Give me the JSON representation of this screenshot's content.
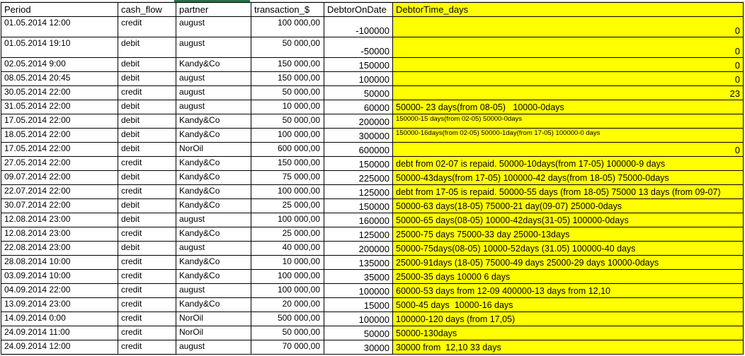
{
  "colors": {
    "highlight_yellow": "#ffff00",
    "selection_green": "#217346",
    "grid_border": "#000000"
  },
  "table": {
    "columns": [
      {
        "label": "Period"
      },
      {
        "label": "cash_flow"
      },
      {
        "label": "partner"
      },
      {
        "label": "transaction_$"
      },
      {
        "label": "DebtorOnDate"
      },
      {
        "label": "DebtorTime_days"
      }
    ],
    "rows": [
      {
        "period": "01.05.2014 12:00",
        "cash_flow": "credit",
        "partner": "august",
        "transaction": "100 000,00",
        "debtor_on_date": "-100000",
        "debtor_time_days": "0",
        "tall": true
      },
      {
        "period": "01.05.2014 19:10",
        "cash_flow": "debit",
        "partner": "august",
        "transaction": "50 000,00",
        "debtor_on_date": "-50000",
        "debtor_time_days": "0",
        "tall": true
      },
      {
        "period": "02.05.2014 9:00",
        "cash_flow": "debit",
        "partner": "Kandy&Co",
        "transaction": "150 000,00",
        "debtor_on_date": "150000",
        "debtor_time_days": "0"
      },
      {
        "period": "08.05.2014 20:45",
        "cash_flow": "debit",
        "partner": "august",
        "transaction": "150 000,00",
        "debtor_on_date": "100000",
        "debtor_time_days": "0"
      },
      {
        "period": "30.05.2014 22:00",
        "cash_flow": "credit",
        "partner": "august",
        "transaction": "50 000,00",
        "debtor_on_date": "50000",
        "debtor_time_days": "23"
      },
      {
        "period": "31.05.2014 22:00",
        "cash_flow": "debit",
        "partner": "august",
        "transaction": "10 000,00",
        "debtor_on_date": "60000",
        "debtor_time_days": "50000- 23 days(from 08-05)   10000-0days"
      },
      {
        "period": "17.05.2014 22:00",
        "cash_flow": "debit",
        "partner": "Kandy&Co",
        "transaction": "50 000,00",
        "debtor_on_date": "200000",
        "debtor_time_days": "150000-15 days(from 02-05) 50000-0days",
        "small": true
      },
      {
        "period": "18.05.2014 22:00",
        "cash_flow": "debit",
        "partner": "Kandy&Co",
        "transaction": "100 000,00",
        "debtor_on_date": "300000",
        "debtor_time_days": "150000-16days(from 02-05) 50000-1day(from 17-05) 100000-0 days",
        "small": true
      },
      {
        "period": "17.05.2014 22:00",
        "cash_flow": "debit",
        "partner": "NorOil",
        "transaction": "600 000,00",
        "debtor_on_date": "600000",
        "debtor_time_days": "0"
      },
      {
        "period": "27.05.2014 22:00",
        "cash_flow": "credit",
        "partner": "Kandy&Co",
        "transaction": "150 000,00",
        "debtor_on_date": "150000",
        "debtor_time_days": "debt from 02-07 is repaid. 50000-10days(from 17-05) 100000-9 days"
      },
      {
        "period": "09.07.2014 22:00",
        "cash_flow": "debit",
        "partner": "Kandy&Co",
        "transaction": "75 000,00",
        "debtor_on_date": "225000",
        "debtor_time_days": "50000-43days(from 17-05) 100000-42 days(from 18-05) 75000-0days"
      },
      {
        "period": "22.07.2014 22:00",
        "cash_flow": "credit",
        "partner": "Kandy&Co",
        "transaction": "100 000,00",
        "debtor_on_date": "125000",
        "debtor_time_days": "debt from 17-05 is repaid. 50000-55 days (from 18-05) 75000 13 days (from 09-07)"
      },
      {
        "period": "30.07.2014 22:00",
        "cash_flow": "debit",
        "partner": "Kandy&Co",
        "transaction": "25 000,00",
        "debtor_on_date": "150000",
        "debtor_time_days": "50000-63 days(18-05) 75000-21 day(09-07) 25000-0days"
      },
      {
        "period": "12.08.2014 23:00",
        "cash_flow": "debit",
        "partner": "august",
        "transaction": "100 000,00",
        "debtor_on_date": "160000",
        "debtor_time_days": "50000-65 days(08-05) 10000-42days(31-05) 100000-0days"
      },
      {
        "period": "12.08.2014 23:00",
        "cash_flow": "credit",
        "partner": "Kandy&Co",
        "transaction": "25 000,00",
        "debtor_on_date": "125000",
        "debtor_time_days": "25000-75 days 75000-33 day 25000-13days"
      },
      {
        "period": "22.08.2014 23:00",
        "cash_flow": "debit",
        "partner": "august",
        "transaction": "40 000,00",
        "debtor_on_date": "200000",
        "debtor_time_days": "50000-75days(08-05) 10000-52days (31.05) 100000-40 days"
      },
      {
        "period": "28.08.2014 10:00",
        "cash_flow": "credit",
        "partner": "Kandy&Co",
        "transaction": "10 000,00",
        "debtor_on_date": "135000",
        "debtor_time_days": "25000-91days (18-05) 75000-49 days 25000-29 days 10000-0days"
      },
      {
        "period": "03.09.2014 10:00",
        "cash_flow": "credit",
        "partner": "Kandy&Co",
        "transaction": "100 000,00",
        "debtor_on_date": "35000",
        "debtor_time_days": "25000-35 days 10000 6 days"
      },
      {
        "period": "04.09.2014 22:00",
        "cash_flow": "credit",
        "partner": "august",
        "transaction": "100 000,00",
        "debtor_on_date": "100000",
        "debtor_time_days": "60000-53 days from 12-09 400000-13 days from 12,10"
      },
      {
        "period": "13.09.2014 23:00",
        "cash_flow": "credit",
        "partner": "Kandy&Co",
        "transaction": "20 000,00",
        "debtor_on_date": "15000",
        "debtor_time_days": "5000-45 days  10000-16 days"
      },
      {
        "period": "14.09.2014 0:00",
        "cash_flow": "credit",
        "partner": "NorOil",
        "transaction": "500 000,00",
        "debtor_on_date": "100000",
        "debtor_time_days": "100000-120 days (from 17,05)"
      },
      {
        "period": "24.09.2014 11:00",
        "cash_flow": "credit",
        "partner": "NorOil",
        "transaction": "50 000,00",
        "debtor_on_date": "50000",
        "debtor_time_days": "50000-130days"
      },
      {
        "period": "24.09.2014 12:00",
        "cash_flow": "credit",
        "partner": "august",
        "transaction": "70 000,00",
        "debtor_on_date": "30000",
        "debtor_time_days": "30000 from  12,10 33 days"
      }
    ]
  }
}
